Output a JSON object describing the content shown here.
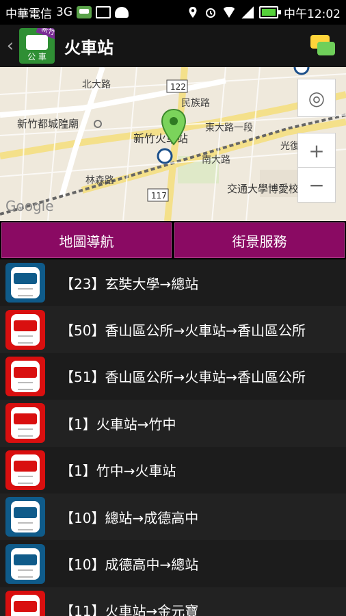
{
  "status_bar": {
    "carrier": "中華電信",
    "network": "3G",
    "time": "中午12:02"
  },
  "header": {
    "title": "火車站"
  },
  "map": {
    "watermark": "Google",
    "roads": [
      "北大路",
      "民族路",
      "東大路一段",
      "光復路",
      "南大路",
      "林森路"
    ],
    "places": [
      "新竹都城隍廟",
      "新竹火車站",
      "交通大學博愛校區"
    ],
    "route_shields": [
      "122",
      "117"
    ]
  },
  "actions": {
    "map_nav": "地圖導航",
    "street_view": "街景服務"
  },
  "colors": {
    "accent": "#8a0a63",
    "bus_blue": "#0f5b8a",
    "bus_red": "#d90f0f"
  },
  "routes": [
    {
      "label": "【23】玄奘大學→總站",
      "color": "blue"
    },
    {
      "label": "【50】香山區公所→火車站→香山區公所",
      "color": "red"
    },
    {
      "label": "【51】香山區公所→火車站→香山區公所",
      "color": "red"
    },
    {
      "label": "【1】火車站→竹中",
      "color": "red"
    },
    {
      "label": "【1】竹中→火車站",
      "color": "red"
    },
    {
      "label": "【10】總站→成德高中",
      "color": "blue"
    },
    {
      "label": "【10】成德高中→總站",
      "color": "blue"
    },
    {
      "label": "【11】火車站→金元寶",
      "color": "red"
    }
  ]
}
